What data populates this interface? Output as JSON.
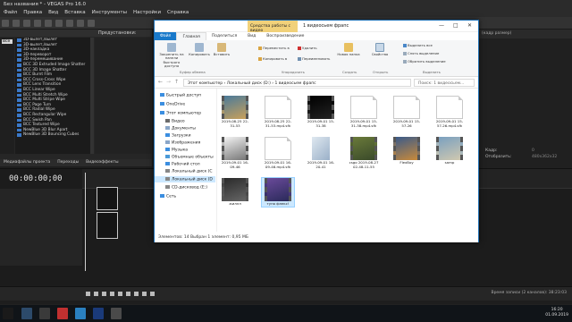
{
  "vegas": {
    "title": "Без названия * - VEGAS Pro 16.0",
    "menu": [
      "Файл",
      "Правка",
      "Вид",
      "Вставка",
      "Инструменты",
      "Настройки",
      "Справка"
    ],
    "fx_header": "",
    "fx_preset_header": "Предустановки:",
    "fx_tree_selected": "Все",
    "fx_items": [
      "3D-вылет,/вылет",
      "3D-вылет,/вылет",
      "3D-накладка",
      "3D-переворот",
      "3D-перемешивание",
      "BCC 3D Extruded Image Shatter",
      "BCC 3D Image Shatter",
      "BCC Burnt Film",
      "BCC Cross-Cross Wipe",
      "BCC Lens Transition",
      "BCC Linear Wipe",
      "BCC Multi Stretch Wipe",
      "BCC Multi Stripe Wipe",
      "BCC Page Turn",
      "BCC Radial Wipe",
      "BCC Rectangular Wipe",
      "BCC Swish Pan",
      "BCC Textured Wipe",
      "NewBlue 3D Blur Apart",
      "NewBlue 3D Bouncing Cubes"
    ],
    "bottom_tabs": [
      "Медиафайлы проекта",
      "Переходы",
      "Видеоэффекты"
    ],
    "timecode": "00:00:00;00",
    "rate_label": "Частота: 0,00",
    "record_time": "Время записи (2 каналов): 38:23:03",
    "right_top": "(кадр размер)",
    "right_labels": [
      "Кадр:",
      "Отобразить:"
    ],
    "right_values": [
      "0",
      "480x362x32"
    ]
  },
  "explorer": {
    "context_tab": "Средства работы с видео",
    "title": "1 видеосьем фрапс",
    "tabs": [
      "Файл",
      "Главная",
      "Поделиться",
      "Вид",
      "Воспроизведение"
    ],
    "ribbon": {
      "pin": "Закрепить на панели быстрого доступа",
      "copy": "Копировать",
      "paste": "Вставить",
      "clip_group": "Буфер обмена",
      "move_to": "Переместить в",
      "copy_to": "Копировать в",
      "delete": "Удалить",
      "rename": "Переименовать",
      "org_group": "Упорядочить",
      "new_folder": "Новая папка",
      "new_group": "Создать",
      "properties": "Свойства",
      "open_group": "Открыть",
      "select_all": "Выделить все",
      "select_none": "Снять выделение",
      "invert": "Обратить выделение",
      "select_group": "Выделить"
    },
    "address": "Этот компьютер  ›  Локальный диск (D:)  ›  1 видеосьем фрапс",
    "search_placeholder": "Поиск: 1 видеосьем...",
    "nav": [
      {
        "label": "Быстрый доступ",
        "color": "#3b8ee0"
      },
      {
        "label": "OneDrive",
        "color": "#3b8ee0"
      },
      {
        "label": "Этот компьютер",
        "color": "#3b8ee0"
      },
      {
        "label": "Видео",
        "color": "#6b6b6b"
      },
      {
        "label": "Документы",
        "color": "#8aa6c8"
      },
      {
        "label": "Загрузки",
        "color": "#3b8ee0"
      },
      {
        "label": "Изображения",
        "color": "#8aa6c8"
      },
      {
        "label": "Музыка",
        "color": "#3b8ee0"
      },
      {
        "label": "Объемные объекты",
        "color": "#4b9ad8"
      },
      {
        "label": "Рабочий стол",
        "color": "#3b8ee0"
      },
      {
        "label": "Локальный диск (C",
        "color": "#888"
      },
      {
        "label": "Локальный диск (D",
        "color": "#888"
      },
      {
        "label": "CD-дисковод (E:)",
        "color": "#888"
      },
      {
        "label": "Сеть",
        "color": "#3b8ee0"
      }
    ],
    "files": [
      {
        "name": "2019-08-25 22-31-53",
        "kind": "vid",
        "c1": "#4a7a9a",
        "c2": "#c9a05a"
      },
      {
        "name": "2019-08-25 22-31-53.mp4.sfk",
        "kind": "doc"
      },
      {
        "name": "2019-09-01 15-31-38",
        "kind": "vid",
        "c1": "#000",
        "c2": "#222"
      },
      {
        "name": "2019-09-01 15-31-38.mp4.sfk",
        "kind": "doc"
      },
      {
        "name": "2019-09-01 15-57-26",
        "kind": "doc"
      },
      {
        "name": "2019-09-01 15-57-26.mp4.sfk",
        "kind": "doc"
      },
      {
        "name": "2019-09-01 16-09-46",
        "kind": "vid",
        "c1": "#f2f2f2",
        "c2": "#777"
      },
      {
        "name": "2019-09-01 16-09-46.mp4.sfk",
        "kind": "doc"
      },
      {
        "name": "2019-09-01 16-20-41",
        "kind": "media"
      },
      {
        "name": "csgo 2019-08-27 02-48-11-55",
        "kind": "vid",
        "c1": "#6a7a3a",
        "c2": "#3a4a2a"
      },
      {
        "name": "FlexBoy",
        "kind": "vid",
        "c1": "#3a5a8a",
        "c2": "#c98a3a"
      },
      {
        "name": "samp",
        "kind": "vid",
        "c1": "#7aa0c0",
        "c2": "#d0c8b0"
      },
      {
        "name": "жиллл",
        "kind": "vid",
        "c1": "#2a2a2a",
        "c2": "#666"
      },
      {
        "name": "тупо флекс!",
        "kind": "vid",
        "c1": "#6a4a9a",
        "c2": "#2a2a5a",
        "selected": true
      }
    ],
    "status": "Элементов: 14     Выбран 1 элемент: 0,95 МБ"
  },
  "taskbar": {
    "time": "16:20",
    "date": "01.09.2019"
  }
}
